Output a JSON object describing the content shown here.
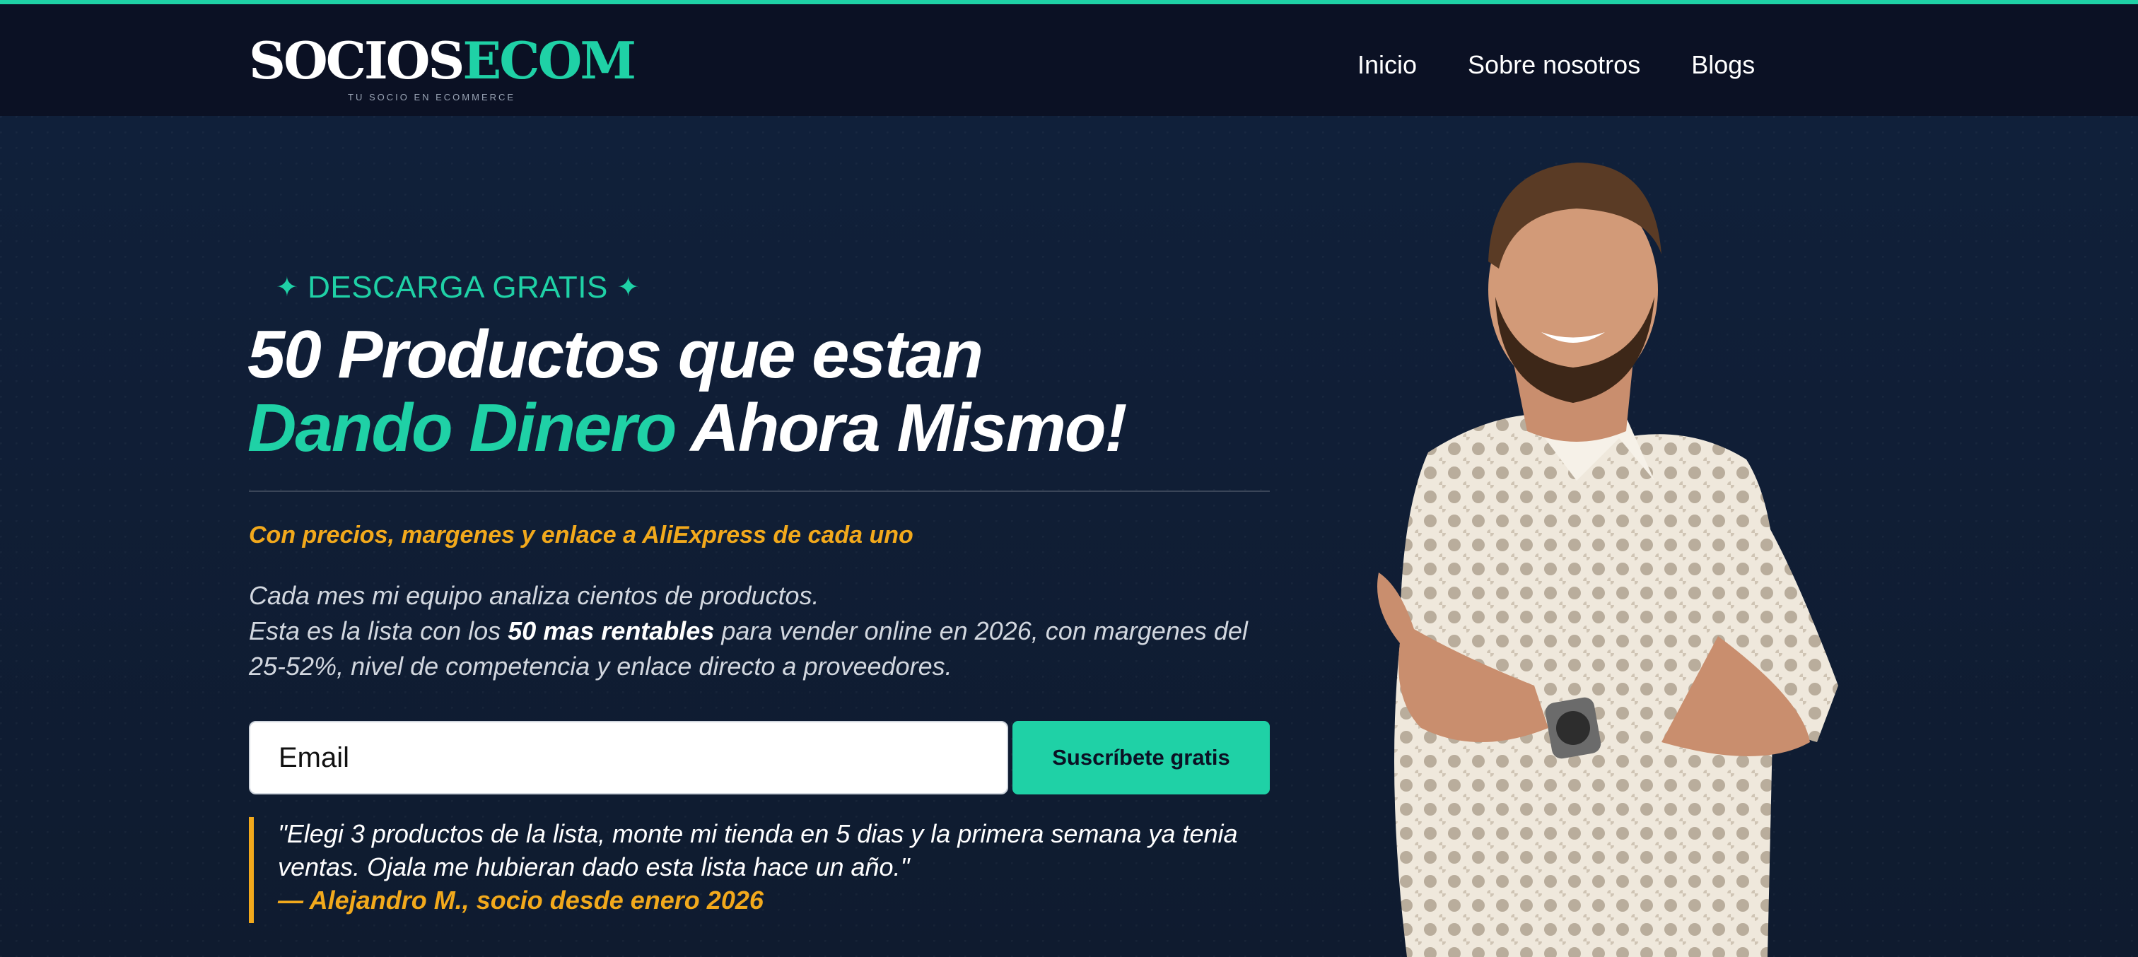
{
  "brand": {
    "name_white": "SOCIOS",
    "name_accent": "ECOM",
    "tagline": "TU SOCIO EN ECOMMERCE"
  },
  "nav": {
    "items": [
      {
        "label": "Inicio"
      },
      {
        "label": "Sobre nosotros"
      },
      {
        "label": "Blogs"
      }
    ]
  },
  "hero": {
    "badge": "DESCARGA GRATIS",
    "badge_icon": "sparkle-icon",
    "headline_line1": "50 Productos que estan",
    "headline_accent": "Dando Dinero",
    "headline_rest": "Ahora Mismo!",
    "subheadline": "Con precios, margenes y enlace a AliExpress de cada uno",
    "desc_line1": "Cada mes mi equipo analiza cientos de productos.",
    "desc_pre": "Esta es la lista con los",
    "desc_bold": "50 mas rentables",
    "desc_post": "para vender online en 2026, con margenes del 25-52%, nivel de competencia y enlace directo a proveedores."
  },
  "form": {
    "email_placeholder": "Email",
    "submit_label": "Suscríbete gratis"
  },
  "testimonial": {
    "text": "\"Elegi 3 productos de la lista, monte mi tienda en 5 dias y la primera semana ya tenia ventas. Ojala me hubieran dado esta lista hace un año.\"",
    "author": "— Alejandro M., socio desde enero 2026"
  },
  "colors": {
    "accent": "#1fd1a6",
    "highlight": "#f2a91c",
    "header_bg": "#0b1124",
    "hero_bg": "#0f1b2f"
  }
}
